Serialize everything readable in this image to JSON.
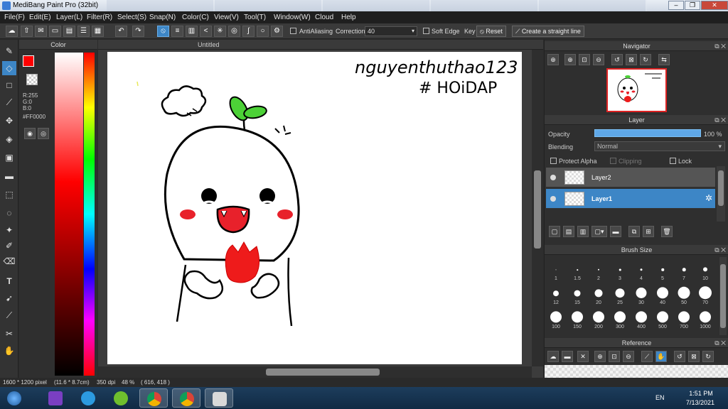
{
  "window": {
    "title": "MediBang Paint Pro (32bit)"
  },
  "menu": [
    "File(F)",
    "Edit(E)",
    "Layer(L)",
    "Filter(R)",
    "Select(S)",
    "Snap(N)",
    "Color(C)",
    "View(V)",
    "Tool(T)",
    "Window(W)",
    "Cloud",
    "Help"
  ],
  "toolbar": {
    "antialiasing_label": "AntiAliasing",
    "correction_label": "Correction",
    "correction_value": "40",
    "soft_edge_label": "Soft Edge",
    "key_label": "Key",
    "reset_label": "Reset",
    "straight_line_label": "Create a straight line"
  },
  "color_panel": {
    "title": "Color",
    "r": "R:255",
    "g": "G:0",
    "b": "B:0",
    "hex": "#FF0000",
    "foreground_color": "#ff0000"
  },
  "document": {
    "tab_title": "Untitled",
    "canvas_text_line1": "nguyenthuthao123",
    "canvas_text_line2": "# HOiDAP"
  },
  "navigator": {
    "title": "Navigator"
  },
  "layer_panel": {
    "title": "Layer",
    "opacity_label": "Opacity",
    "opacity_value": "100 %",
    "opacity_percent": 100,
    "blending_label": "Blending",
    "blending_value": "Normal",
    "protect_alpha_label": "Protect Alpha",
    "clipping_label": "Clipping",
    "lock_label": "Lock",
    "layers": [
      {
        "name": "Layer2",
        "selected": false
      },
      {
        "name": "Layer1",
        "selected": true
      }
    ]
  },
  "brush_size": {
    "title": "Brush Size",
    "sizes": [
      "1",
      "1.5",
      "2",
      "3",
      "4",
      "5",
      "7",
      "10",
      "12",
      "15",
      "20",
      "25",
      "30",
      "40",
      "50",
      "70",
      "100",
      "150",
      "200",
      "300",
      "400",
      "500",
      "700",
      "1000"
    ]
  },
  "reference": {
    "title": "Reference"
  },
  "status": {
    "dimensions": "1600 * 1200 pixel",
    "cm": "(11.6 * 8.7cm)",
    "dpi": "350 dpi",
    "zoom": "48 %",
    "cursor": "( 616, 418 )"
  },
  "taskbar": {
    "lang": "EN",
    "time": "1:51 PM",
    "date": "7/13/2021"
  }
}
